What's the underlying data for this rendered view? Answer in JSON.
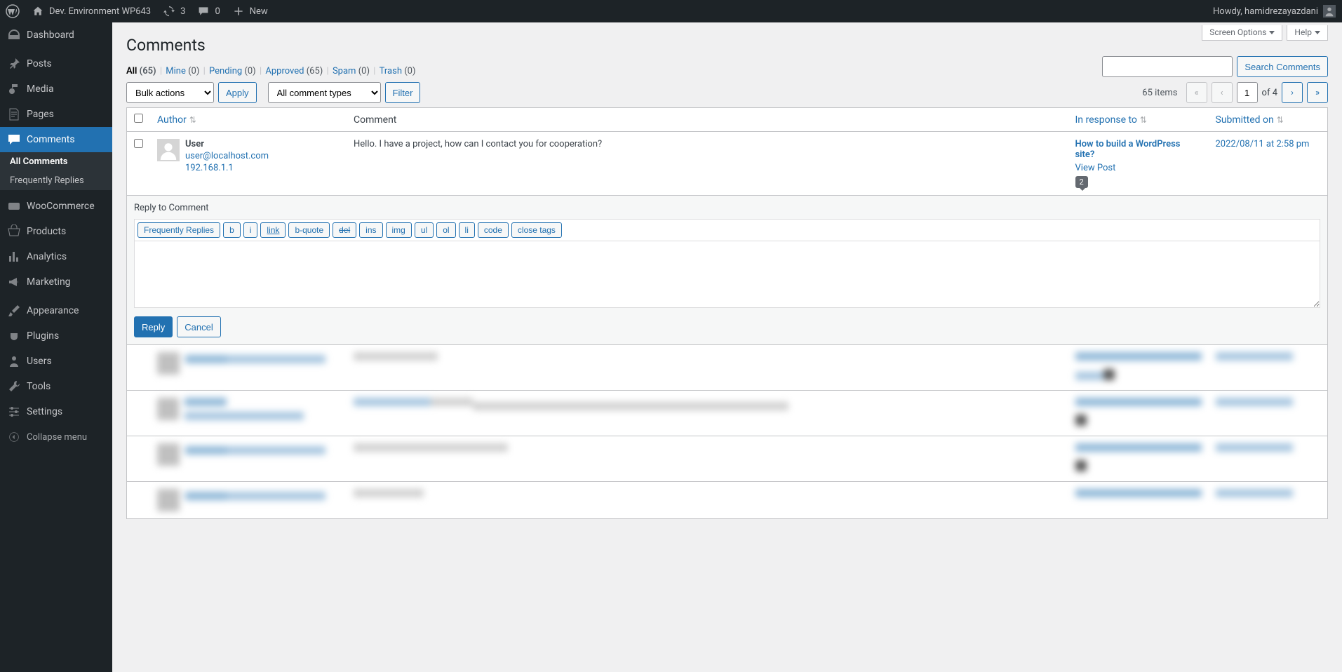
{
  "adminbar": {
    "site_name": "Dev. Environment WP643",
    "updates_count": "3",
    "comments_count": "0",
    "new_label": "New",
    "howdy": "Howdy, hamidrezayazdani"
  },
  "sidebar": {
    "items": [
      {
        "label": "Dashboard"
      },
      {
        "label": "Posts"
      },
      {
        "label": "Media"
      },
      {
        "label": "Pages"
      },
      {
        "label": "Comments"
      },
      {
        "label": "WooCommerce"
      },
      {
        "label": "Products"
      },
      {
        "label": "Analytics"
      },
      {
        "label": "Marketing"
      },
      {
        "label": "Appearance"
      },
      {
        "label": "Plugins"
      },
      {
        "label": "Users"
      },
      {
        "label": "Tools"
      },
      {
        "label": "Settings"
      }
    ],
    "submenu": [
      {
        "label": "All Comments"
      },
      {
        "label": "Frequently Replies"
      }
    ],
    "collapse": "Collapse menu"
  },
  "screen_meta": {
    "screen_options": "Screen Options",
    "help": "Help"
  },
  "page": {
    "title": "Comments"
  },
  "filters": {
    "all": "All",
    "all_count": "(65)",
    "mine": "Mine",
    "mine_count": "(0)",
    "pending": "Pending",
    "pending_count": "(0)",
    "approved": "Approved",
    "approved_count": "(65)",
    "spam": "Spam",
    "spam_count": "(0)",
    "trash": "Trash",
    "trash_count": "(0)"
  },
  "bulk": {
    "bulk_actions": "Bulk actions",
    "apply": "Apply",
    "comment_types": "All comment types",
    "filter": "Filter"
  },
  "search": {
    "button": "Search Comments"
  },
  "pagination": {
    "items": "65 items",
    "current": "1",
    "total_text": "of 4"
  },
  "columns": {
    "author": "Author",
    "comment": "Comment",
    "response": "In response to",
    "date": "Submitted on"
  },
  "comment1": {
    "author_name": "User",
    "author_email": "user@localhost.com",
    "author_ip": "192.168.1.1",
    "body": "Hello. I have a project, how can I contact you for cooperation?",
    "post_title": "How to build a WordPress site?",
    "view_post": "View Post",
    "count": "2",
    "date": "2022/08/11 at 2:58 pm"
  },
  "reply": {
    "title": "Reply to Comment",
    "buttons": {
      "freq": "Frequently Replies",
      "b": "b",
      "i": "i",
      "link": "link",
      "bquote": "b-quote",
      "del": "del",
      "ins": "ins",
      "img": "img",
      "ul": "ul",
      "ol": "ol",
      "li": "li",
      "code": "code",
      "close": "close tags"
    },
    "submit": "Reply",
    "cancel": "Cancel"
  }
}
